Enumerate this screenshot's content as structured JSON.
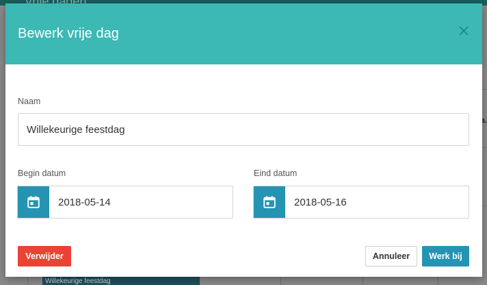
{
  "background": {
    "title": "Vrije dagen",
    "cut_text_1": "...",
    "cut_text_2": "a.",
    "bottom_row_text": "Willekeurige feestdag"
  },
  "modal": {
    "title": "Bewerk vrije dag",
    "close_icon": "close-icon",
    "name_label": "Naam",
    "name_value": "Willekeurige feestdag",
    "start_label": "Begin datum",
    "start_value": "2018-05-14",
    "end_label": "Eind datum",
    "end_value": "2018-05-16",
    "calendar_icon": "calendar-icon",
    "delete_label": "Verwijder",
    "cancel_label": "Annuleer",
    "update_label": "Werk bij"
  },
  "colors": {
    "header": "#3cb8b5",
    "primary": "#2594b3",
    "danger": "#ea4335"
  }
}
